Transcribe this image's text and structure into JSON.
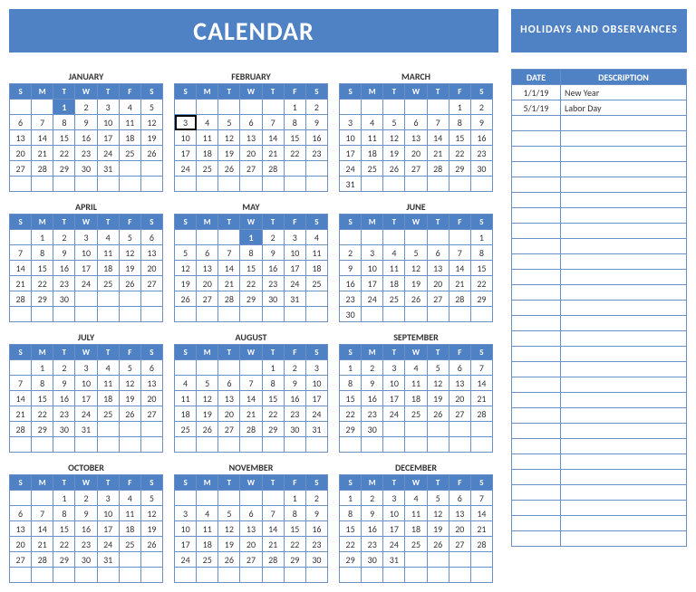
{
  "header": {
    "calendar_title": "CALENDAR",
    "holidays_title": "HOLIDAYS AND OBSERVANCES"
  },
  "daylabels": [
    "S",
    "M",
    "T",
    "W",
    "T",
    "F",
    "S"
  ],
  "holiday_headers": {
    "date": "DATE",
    "description": "DESCRIPTION"
  },
  "holidays": [
    {
      "date": "1/1/19",
      "description": "New Year"
    },
    {
      "date": "5/1/19",
      "description": "Labor Day"
    }
  ],
  "holiday_empty_rows": 28,
  "months": [
    {
      "name": "JANUARY",
      "start": 2,
      "days": 31,
      "highlight": [
        1
      ],
      "selected": []
    },
    {
      "name": "FEBRUARY",
      "start": 5,
      "days": 28,
      "highlight": [],
      "selected": [
        3
      ]
    },
    {
      "name": "MARCH",
      "start": 5,
      "days": 31,
      "highlight": [],
      "selected": []
    },
    {
      "name": "APRIL",
      "start": 1,
      "days": 30,
      "highlight": [],
      "selected": []
    },
    {
      "name": "MAY",
      "start": 3,
      "days": 31,
      "highlight": [
        1
      ],
      "selected": []
    },
    {
      "name": "JUNE",
      "start": 6,
      "days": 30,
      "highlight": [],
      "selected": []
    },
    {
      "name": "JULY",
      "start": 1,
      "days": 31,
      "highlight": [],
      "selected": []
    },
    {
      "name": "AUGUST",
      "start": 4,
      "days": 31,
      "highlight": [],
      "selected": []
    },
    {
      "name": "SEPTEMBER",
      "start": 0,
      "days": 30,
      "highlight": [],
      "selected": []
    },
    {
      "name": "OCTOBER",
      "start": 2,
      "days": 31,
      "highlight": [],
      "selected": []
    },
    {
      "name": "NOVEMBER",
      "start": 5,
      "days": 30,
      "highlight": [],
      "selected": []
    },
    {
      "name": "DECEMBER",
      "start": 0,
      "days": 31,
      "highlight": [],
      "selected": []
    }
  ]
}
